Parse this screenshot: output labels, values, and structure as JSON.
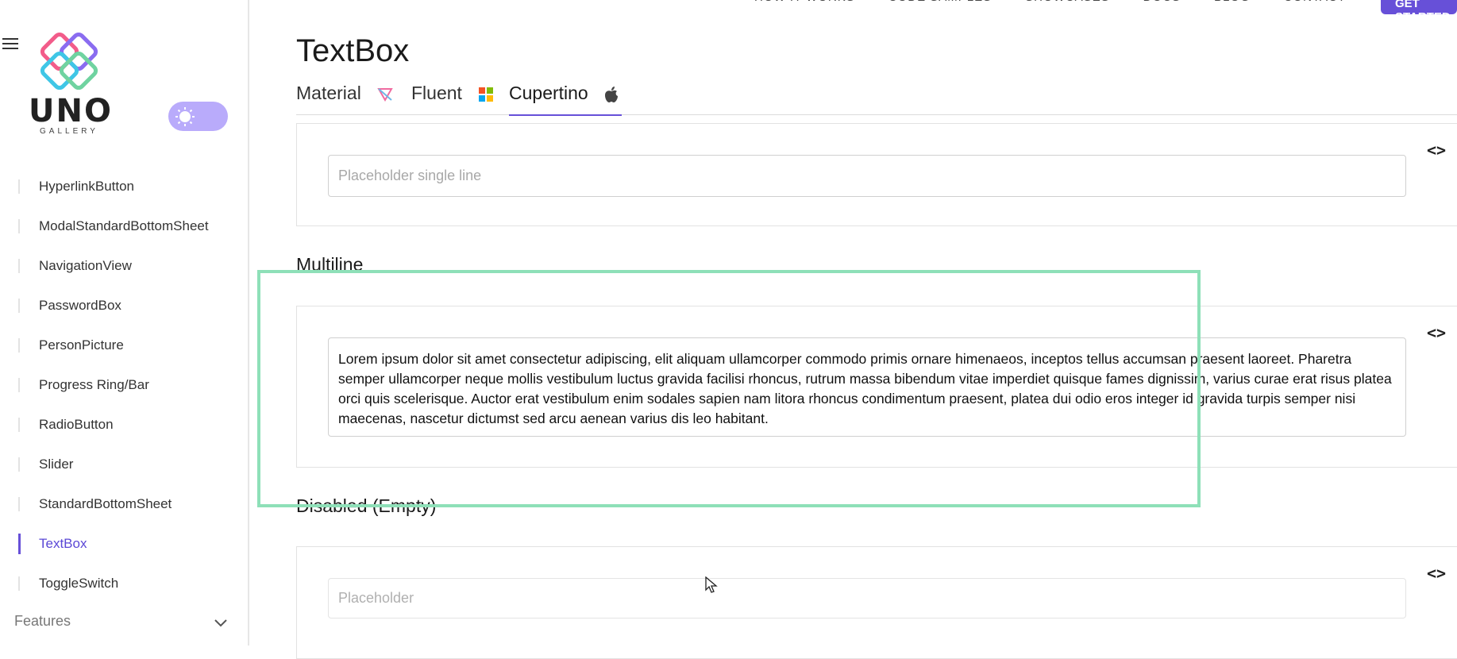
{
  "topnav": {
    "items": [
      "HOW IT WORKS",
      "CODE SAMPLES",
      "SHOWCASES",
      "DOCS",
      "BLOG",
      "CONTACT"
    ],
    "cta": "GET STARTED"
  },
  "sidebar": {
    "logo_word": "UNO",
    "logo_sub": "GALLERY",
    "items": [
      {
        "label": "HyperlinkButton",
        "active": false
      },
      {
        "label": "ModalStandardBottomSheet",
        "active": false
      },
      {
        "label": "NavigationView",
        "active": false
      },
      {
        "label": "PasswordBox",
        "active": false
      },
      {
        "label": "PersonPicture",
        "active": false
      },
      {
        "label": "Progress Ring/Bar",
        "active": false
      },
      {
        "label": "RadioButton",
        "active": false
      },
      {
        "label": "Slider",
        "active": false
      },
      {
        "label": "StandardBottomSheet",
        "active": false
      },
      {
        "label": "TextBox",
        "active": true
      },
      {
        "label": "ToggleSwitch",
        "active": false
      }
    ],
    "features_label": "Features"
  },
  "page": {
    "title": "TextBox",
    "tabs": [
      {
        "label": "Material",
        "icon": "material-icon"
      },
      {
        "label": "Fluent",
        "icon": "windows-icon"
      },
      {
        "label": "Cupertino",
        "icon": "apple-icon",
        "active": true
      }
    ]
  },
  "samples": {
    "single_line_placeholder": "Placeholder single line",
    "multiline_title": "Multiline",
    "multiline_text": " Lorem ipsum dolor sit amet consectetur adipiscing, elit aliquam ullamcorper commodo primis ornare himenaeos, inceptos tellus accumsan praesent laoreet. Pharetra semper ullamcorper neque mollis vestibulum luctus gravida facilisi rhoncus, rutrum massa bibendum vitae imperdiet quisque fames dignissim, varius curae erat risus platea orci quis scelerisque. Auctor erat vestibulum enim sodales sapien nam litora rhoncus condimentum praesent, platea dui odio eros integer id gravida turpis semper nisi maecenas, nascetur dictumst sed arcu aenean varius dis leo habitant.",
    "disabled_title": "Disabled (Empty)",
    "disabled_placeholder": "Placeholder",
    "code_glyph": "<>"
  },
  "colors": {
    "accent": "#6750d8",
    "toggle": "#b9abfb",
    "highlight": "#8ee0b8"
  }
}
